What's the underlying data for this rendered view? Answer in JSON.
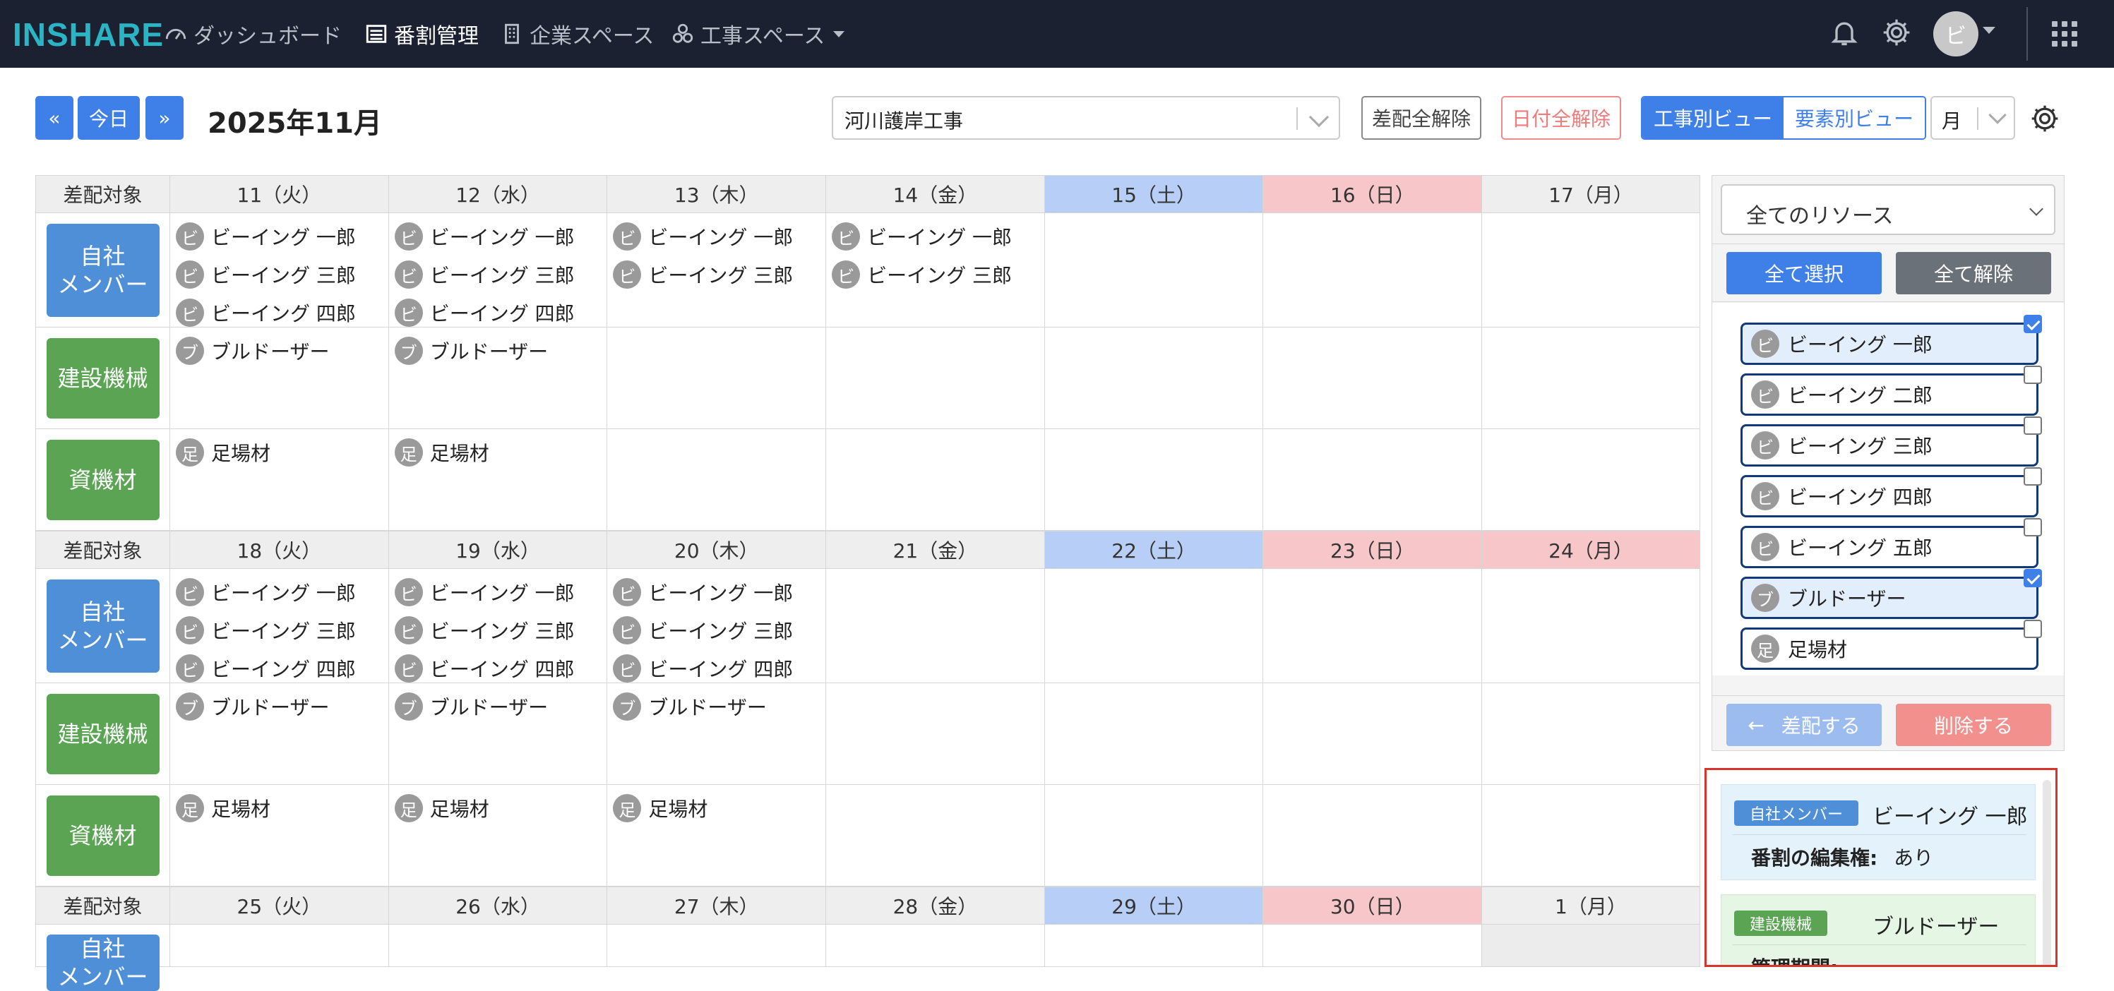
{
  "nav": {
    "logo": "INSHARE",
    "items": [
      {
        "label": "ダッシュボード",
        "icon": "dashboard-icon"
      },
      {
        "label": "番割管理",
        "icon": "list-icon"
      },
      {
        "label": "企業スペース",
        "icon": "building-icon"
      },
      {
        "label": "工事スペース",
        "icon": "cogs-icon"
      }
    ],
    "avatar": "ビ"
  },
  "toolbar": {
    "prev": "«",
    "today": "今日",
    "next": "»",
    "month_title": "2025年11月",
    "project_select": "河川護岸工事",
    "clear_assign": "差配全解除",
    "clear_dates": "日付全解除",
    "view_by_project": "工事別ビュー",
    "view_by_element": "要素別ビュー",
    "period": "月"
  },
  "calendar": {
    "label_header": "差配対象",
    "categories": [
      "自社\nメンバー",
      "建設機械",
      "資機材"
    ],
    "weeks": [
      {
        "days": [
          "11（火）",
          "12（水）",
          "13（木）",
          "14（金）",
          "15（土）",
          "16（日）",
          "17（月）"
        ],
        "members": [
          [
            "ビーイング 一郎",
            "ビーイング 三郎",
            "ビーイング 四郎"
          ],
          [
            "ビーイング 一郎",
            "ビーイング 三郎",
            "ビーイング 四郎"
          ],
          [
            "ビーイング 一郎",
            "ビーイング 三郎"
          ],
          [
            "ビーイング 一郎",
            "ビーイング 三郎"
          ],
          [],
          [],
          []
        ],
        "machines": [
          [
            "ブルドーザー"
          ],
          [
            "ブルドーザー"
          ],
          [],
          [],
          [],
          [],
          []
        ],
        "materials": [
          [
            "足場材"
          ],
          [
            "足場材"
          ],
          [],
          [],
          [],
          [],
          []
        ]
      },
      {
        "days": [
          "18（火）",
          "19（水）",
          "20（木）",
          "21（金）",
          "22（土）",
          "23（日）",
          "24（月）"
        ],
        "members": [
          [
            "ビーイング 一郎",
            "ビーイング 三郎",
            "ビーイング 四郎"
          ],
          [
            "ビーイング 一郎",
            "ビーイング 三郎",
            "ビーイング 四郎"
          ],
          [
            "ビーイング 一郎",
            "ビーイング 三郎",
            "ビーイング 四郎"
          ],
          [],
          [],
          [],
          []
        ],
        "machines": [
          [
            "ブルドーザー"
          ],
          [
            "ブルドーザー"
          ],
          [
            "ブルドーザー"
          ],
          [],
          [],
          [],
          []
        ],
        "materials": [
          [
            "足場材"
          ],
          [
            "足場材"
          ],
          [
            "足場材"
          ],
          [],
          [],
          [],
          []
        ]
      },
      {
        "days": [
          "25（火）",
          "26（水）",
          "27（木）",
          "28（金）",
          "29（土）",
          "30（日）",
          "1（月）"
        ]
      }
    ]
  },
  "sidebar": {
    "resource_filter": "全てのリソース",
    "select_all": "全て選択",
    "deselect_all": "全て解除",
    "resources": [
      {
        "icon": "ビ",
        "name": "ビーイング 一郎",
        "checked": true
      },
      {
        "icon": "ビ",
        "name": "ビーイング 二郎",
        "checked": false
      },
      {
        "icon": "ビ",
        "name": "ビーイング 三郎",
        "checked": false
      },
      {
        "icon": "ビ",
        "name": "ビーイング 四郎",
        "checked": false
      },
      {
        "icon": "ビ",
        "name": "ビーイング 五郎",
        "checked": false
      },
      {
        "icon": "ブ",
        "name": "ブルドーザー",
        "checked": true
      },
      {
        "icon": "足",
        "name": "足場材",
        "checked": false
      }
    ],
    "assign_button": "差配する",
    "delete_button": "削除する"
  },
  "detail": {
    "card1": {
      "badge": "自社メンバー",
      "name": "ビーイング 一郎",
      "key": "番割の編集権:",
      "value": "あり"
    },
    "card2": {
      "badge": "建設機械",
      "name": "ブルドーザー",
      "key": "管理期間:"
    }
  },
  "colors": {
    "accent": "#3f7fe8",
    "member": "#4f8fd8",
    "machine": "#5aa454",
    "saturday": "#b7cff7",
    "sunday": "#f6c6c9",
    "highlight_border": "#d9342b"
  }
}
